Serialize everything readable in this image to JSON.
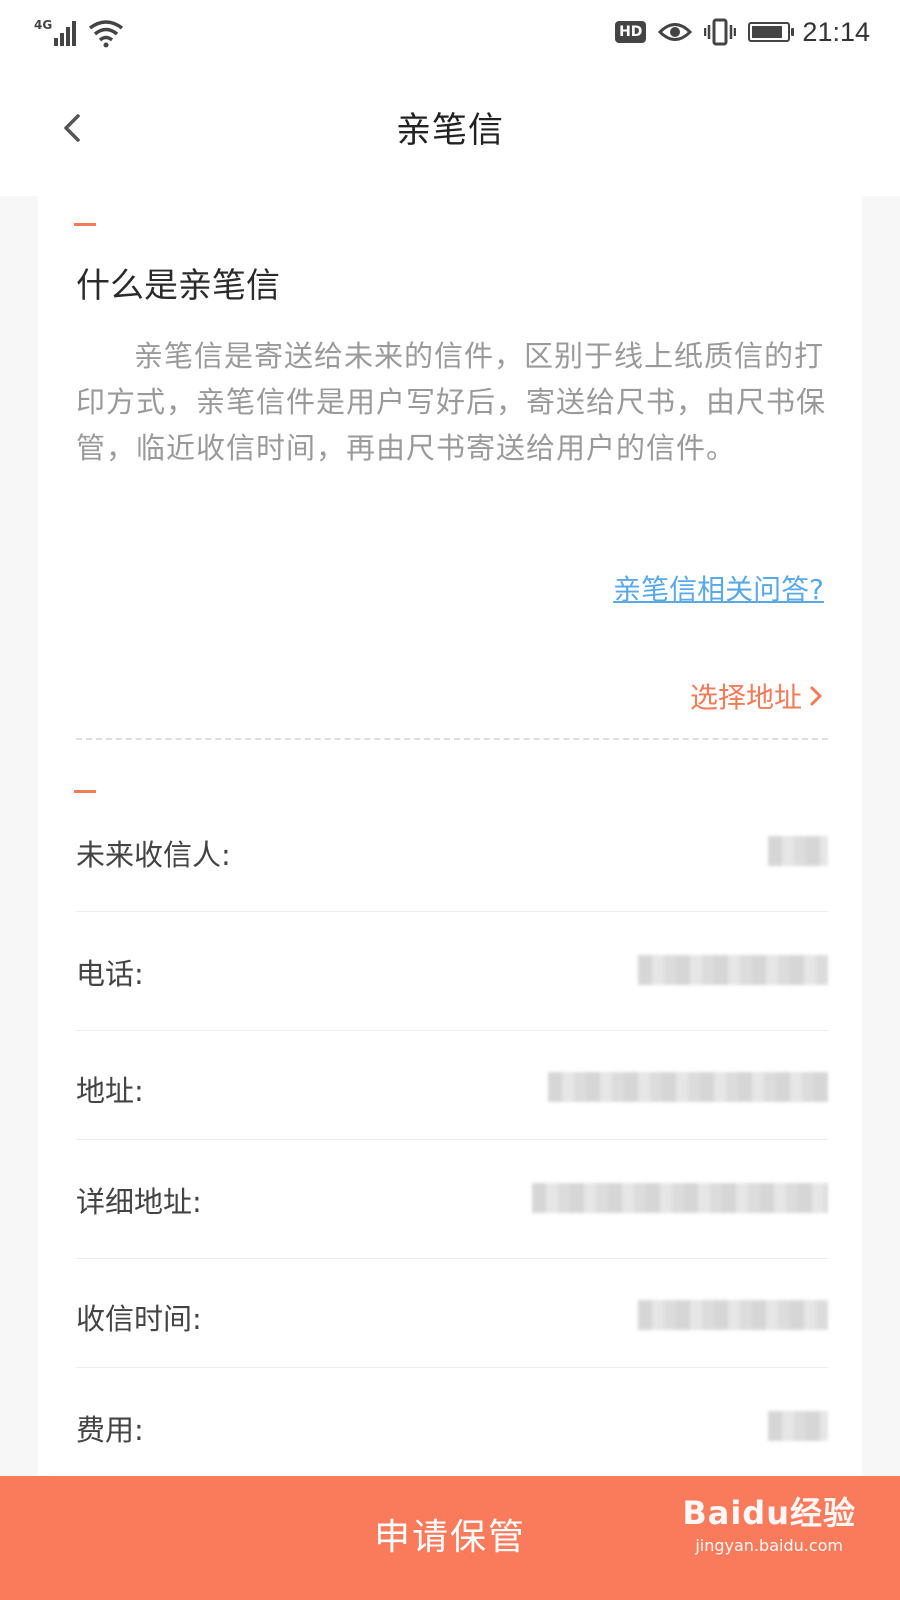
{
  "status_bar": {
    "network": "4G",
    "hd_badge": "HD",
    "time": "21:14"
  },
  "nav": {
    "title": "亲笔信"
  },
  "intro": {
    "heading": "什么是亲笔信",
    "description": "亲笔信是寄送给未来的信件，区别于线上纸质信的打印方式，亲笔信件是用户写好后，寄送给尺书，由尺书保管，临近收信时间，再由尺书寄送给用户的信件。",
    "faq_link": "亲笔信相关问答?",
    "select_address": "选择地址"
  },
  "form": {
    "rows": [
      {
        "label": "未来收信人:",
        "value": ""
      },
      {
        "label": "电话:",
        "value": ""
      },
      {
        "label": "地址:",
        "value": ""
      },
      {
        "label": "详细地址:",
        "value": ""
      },
      {
        "label": "收信时间:",
        "value": ""
      },
      {
        "label": "费用:",
        "value": ""
      }
    ]
  },
  "submit": {
    "label": "申请保管"
  },
  "watermark": {
    "top": "Baidu经验",
    "bottom": "jingyan.baidu.com"
  },
  "colors": {
    "accent": "#f37b5a",
    "button": "#f97b5c",
    "link": "#5aa9e6"
  }
}
